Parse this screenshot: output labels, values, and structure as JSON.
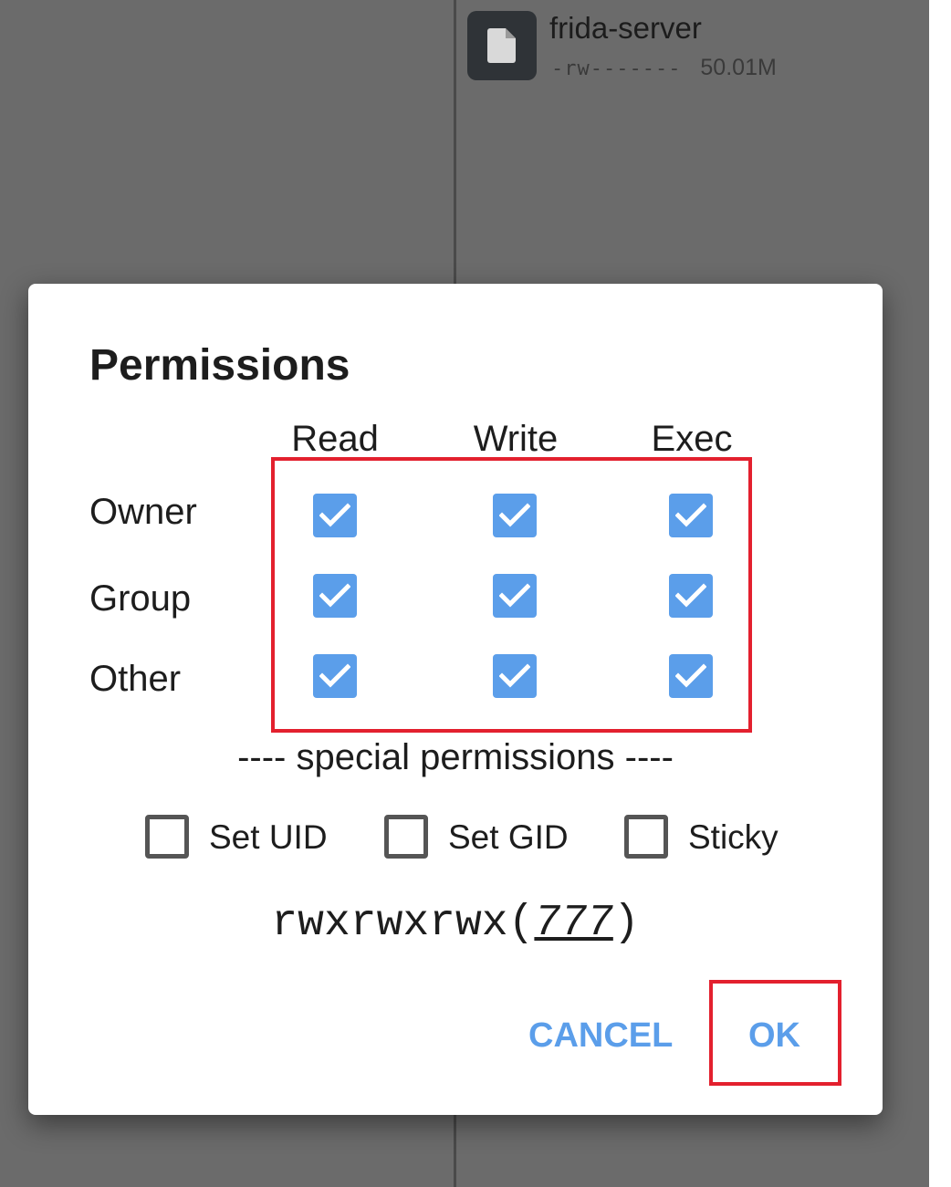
{
  "background_file": {
    "name": "frida-server",
    "permissions": "-rw-------",
    "size": "50.01M",
    "icon": "file-icon"
  },
  "dialog": {
    "title": "Permissions",
    "columns": [
      "Read",
      "Write",
      "Exec"
    ],
    "rows": [
      {
        "label": "Owner",
        "read": true,
        "write": true,
        "exec": true
      },
      {
        "label": "Group",
        "read": true,
        "write": true,
        "exec": true
      },
      {
        "label": "Other",
        "read": true,
        "write": true,
        "exec": true
      }
    ],
    "special_label": "---- special permissions ----",
    "special": [
      {
        "label": "Set UID",
        "checked": false
      },
      {
        "label": "Set GID",
        "checked": false
      },
      {
        "label": "Sticky",
        "checked": false
      }
    ],
    "mode_symbolic": "rwxrwxrwx",
    "mode_octal": "777",
    "buttons": {
      "cancel": "CANCEL",
      "ok": "OK"
    }
  },
  "colors": {
    "accent": "#5b9eea",
    "highlight": "#e3202e",
    "scrim": "#6b6b6b"
  }
}
